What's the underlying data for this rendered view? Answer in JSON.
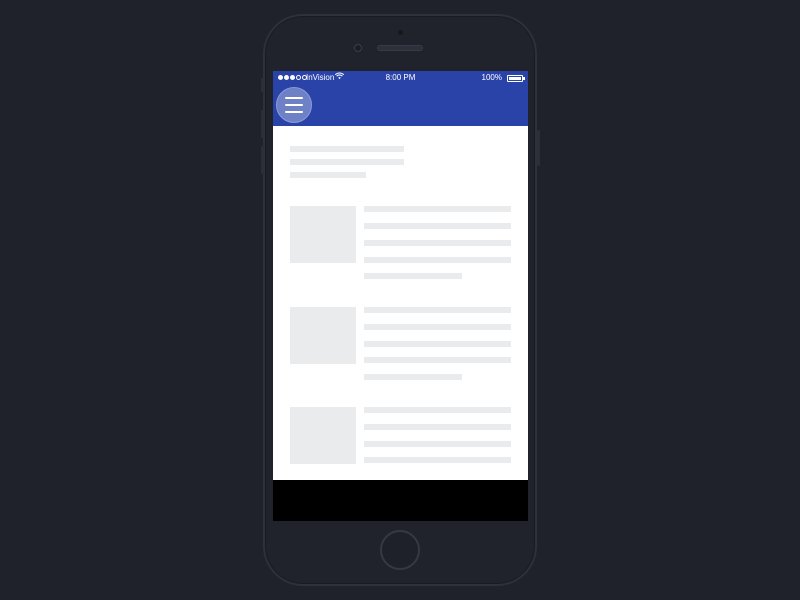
{
  "status_bar": {
    "carrier": "InVision",
    "signal_bars_filled": 3,
    "signal_bars_total": 5,
    "wifi_icon": "wifi-icon",
    "time": "8:00 PM",
    "battery_percent": "100%",
    "battery_icon": "battery-icon"
  },
  "header": {
    "background_color": "#2a43a8",
    "menu_icon": "hamburger-menu-icon"
  },
  "content": {
    "state": "loading-skeleton",
    "list_items": 3
  },
  "colors": {
    "page_background": "#1f222b",
    "skeleton": "#eaebed"
  }
}
